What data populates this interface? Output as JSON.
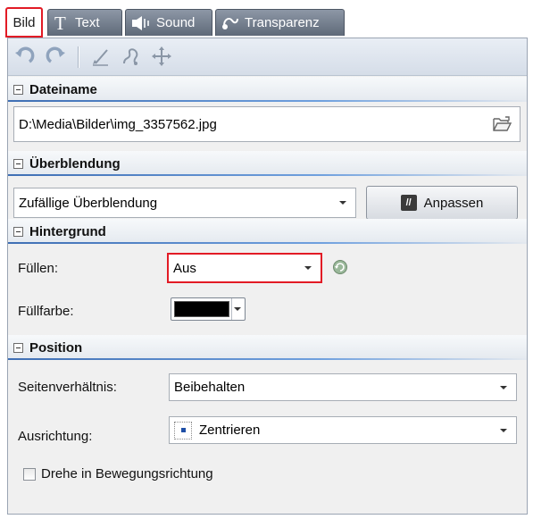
{
  "tabs": [
    {
      "label": "Bild",
      "icon": "image-tab",
      "active": true
    },
    {
      "label": "Text",
      "icon": "text-t-icon"
    },
    {
      "label": "Sound",
      "icon": "speaker-icon"
    },
    {
      "label": "Transparenz",
      "icon": "transparency-icon"
    }
  ],
  "toolbar": {
    "icons": [
      "rotate-left-icon",
      "rotate-right-icon",
      "edit-brush-icon",
      "motion-path-icon",
      "move-crosshair-icon"
    ]
  },
  "sections": {
    "dateiname": {
      "title": "Dateiname",
      "file_path": "D:\\Media\\Bilder\\img_3357562.jpg",
      "browse_icon": "folder-open-icon"
    },
    "ueberblendung": {
      "title": "Überblendung",
      "selected": "Zufällige Überblendung",
      "adjust_button": "Anpassen"
    },
    "hintergrund": {
      "title": "Hintergrund",
      "fuellen_label": "Füllen:",
      "fuellen_value": "Aus",
      "fuellfarbe_label": "Füllfarbe:",
      "fuellfarbe_color": "#000000"
    },
    "position": {
      "title": "Position",
      "seitenverhaeltnis_label": "Seitenverhältnis:",
      "seitenverhaeltnis_value": "Beibehalten",
      "ausrichtung_label": "Ausrichtung:",
      "ausrichtung_value": "Zentrieren",
      "drehe_label": "Drehe in Bewegungsrichtung",
      "drehe_checked": false
    }
  },
  "colors": {
    "highlight": "#e21b25",
    "section_rule": "#3f6fb4",
    "tab_inactive": "#6d7785"
  }
}
